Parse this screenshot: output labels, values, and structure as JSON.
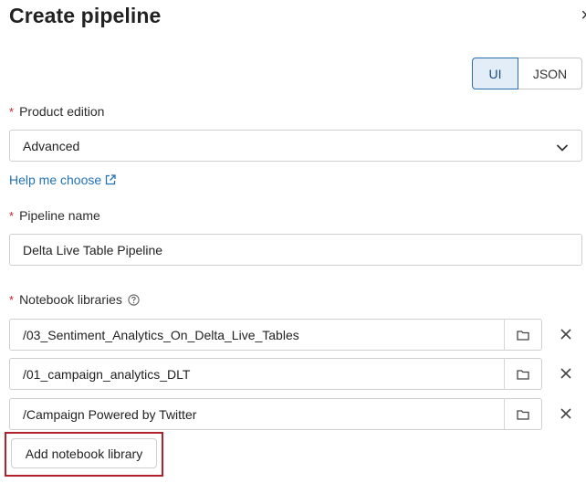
{
  "dialog": {
    "title": "Create pipeline",
    "close_glyph": "×"
  },
  "view_toggle": {
    "options": [
      "UI",
      "JSON"
    ],
    "selected": "UI"
  },
  "product_edition": {
    "label": "Product edition",
    "required_mark": "*",
    "value": "Advanced"
  },
  "help_link": {
    "label": "Help me choose"
  },
  "pipeline_name": {
    "label": "Pipeline name",
    "required_mark": "*",
    "value": "Delta Live Table Pipeline"
  },
  "notebook_libraries": {
    "label": "Notebook libraries",
    "required_mark": "*",
    "items": [
      {
        "path": "/03_Sentiment_Analytics_On_Delta_Live_Tables"
      },
      {
        "path": "/01_campaign_analytics_DLT"
      },
      {
        "path": "/Campaign Powered by Twitter"
      }
    ],
    "add_button": "Add notebook library"
  },
  "colors": {
    "accent": "#2272b4",
    "required": "#c8232c",
    "highlight": "#b0212b",
    "toggle_selected_bg": "#e3edf7"
  },
  "icons": [
    "close-icon",
    "chevron-down-icon",
    "external-link-icon",
    "help-circle-icon",
    "folder-icon",
    "remove-icon"
  ]
}
